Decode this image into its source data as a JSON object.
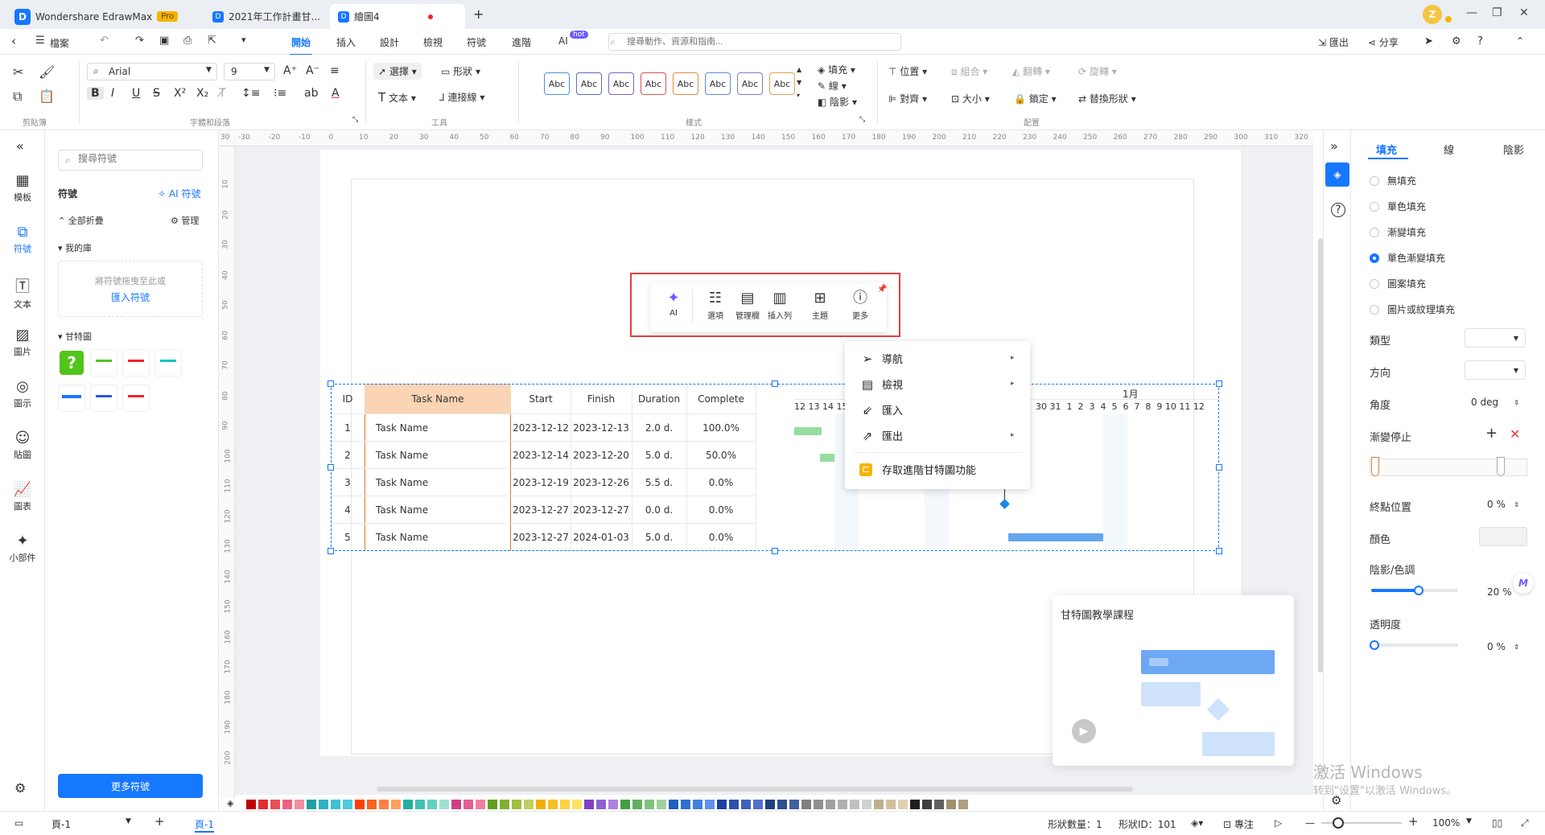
{
  "titlebar": {
    "app_logo": "D",
    "app_name": "Wondershare EdrawMax",
    "pro_badge": "Pro",
    "tabs": [
      {
        "label": "2021年工作計畫甘..."
      },
      {
        "label": "繪圖4"
      }
    ],
    "new_tab": "+",
    "avatar_letter": "Z"
  },
  "menubar": {
    "file": "檔案",
    "items": [
      "開始",
      "插入",
      "設計",
      "檢視",
      "符號",
      "進階",
      "AI"
    ],
    "ai_badge": "hot",
    "search_placeholder": "搜尋動作、資源和指南...",
    "export": "匯出",
    "share": "分享"
  },
  "ribbon": {
    "font_name": "Arial",
    "font_size": "9",
    "select": "選擇",
    "shape": "形狀",
    "text": "文本",
    "connector": "連接線",
    "style_sample": "Abc",
    "style_colors": [
      "#4a90d9",
      "#5b6abf",
      "#7b61c9",
      "#d9534f",
      "#e08a3c",
      "#5b8bd9",
      "#7a7fc9",
      "#e0a050"
    ],
    "fill": "填充",
    "line": "線",
    "shadow": "陰影",
    "position": "位置",
    "group": "組合",
    "flip": "翻轉",
    "rotate": "旋轉",
    "align": "對齊",
    "size": "大小",
    "lock": "鎖定",
    "replace_shape": "替換形狀",
    "group_labels": [
      "剪貼簿",
      "字體和段落",
      "工具",
      "樣式",
      "配置"
    ]
  },
  "leftnav": [
    {
      "label": "模板",
      "icon": "template-icon"
    },
    {
      "label": "符號",
      "icon": "symbol-icon"
    },
    {
      "label": "文本",
      "icon": "text-icon"
    },
    {
      "label": "圖片",
      "icon": "image-icon"
    },
    {
      "label": "圖示",
      "icon": "icon-icon"
    },
    {
      "label": "貼圖",
      "icon": "sticker-icon"
    },
    {
      "label": "圖表",
      "icon": "chart-icon"
    },
    {
      "label": "小部件",
      "icon": "widget-icon"
    }
  ],
  "symbols": {
    "search_placeholder": "搜尋符號",
    "title": "符號",
    "ai_symbol": "AI 符號",
    "collapse_all": "全部折疊",
    "manage": "管理",
    "my_library": "我的庫",
    "drop_hint": "將符號拖曳至此或",
    "import_link": "匯入符號",
    "gantt_section": "甘特圖",
    "more_button": "更多符號"
  },
  "ruler": {
    "h": [
      "-30",
      "-20",
      "-10",
      "0",
      "10",
      "20",
      "30",
      "40",
      "50",
      "60",
      "70",
      "80",
      "90",
      "100",
      "110",
      "120",
      "130",
      "140",
      "150",
      "160",
      "170",
      "180",
      "190",
      "200",
      "210",
      "220",
      "230",
      "240",
      "250",
      "260",
      "270",
      "280",
      "290",
      "300",
      "310",
      "320"
    ],
    "v": [
      "10",
      "20",
      "30",
      "40",
      "50",
      "60",
      "70",
      "80",
      "90",
      "100",
      "110",
      "120",
      "130",
      "140",
      "150",
      "160",
      "170",
      "180",
      "190",
      "200"
    ],
    "h_origin": "30"
  },
  "gantt": {
    "headers": [
      "ID",
      "Task Name",
      "Start",
      "Finish",
      "Duration",
      "Complete"
    ],
    "month_label": "1月",
    "day_labels": "12 13 14 15",
    "day_labels_right": "30 31  1  2  3  4  5  6  7  8  9 10 11 12",
    "rows": [
      {
        "id": "1",
        "name": "Task Name",
        "start": "2023-12-12",
        "finish": "2023-12-13",
        "duration": "2.0 d.",
        "complete": "100.0%"
      },
      {
        "id": "2",
        "name": "Task Name",
        "start": "2023-12-14",
        "finish": "2023-12-20",
        "duration": "5.0 d.",
        "complete": "50.0%"
      },
      {
        "id": "3",
        "name": "Task Name",
        "start": "2023-12-19",
        "finish": "2023-12-26",
        "duration": "5.5 d.",
        "complete": "0.0%"
      },
      {
        "id": "4",
        "name": "Task Name",
        "start": "2023-12-27",
        "finish": "2023-12-27",
        "duration": "0.0 d.",
        "complete": "0.0%"
      },
      {
        "id": "5",
        "name": "Task Name",
        "start": "2023-12-27",
        "finish": "2024-01-03",
        "duration": "5.0 d.",
        "complete": "0.0%"
      }
    ]
  },
  "floatbar": {
    "items": [
      "AI",
      "選項",
      "管理欄",
      "插入列",
      "主題",
      "更多"
    ]
  },
  "context_menu": {
    "items": [
      {
        "label": "導航",
        "submenu": true
      },
      {
        "label": "檢視",
        "submenu": true
      },
      {
        "label": "匯入",
        "submenu": false
      },
      {
        "label": "匯出",
        "submenu": true
      },
      {
        "label": "存取進階甘特圖功能",
        "submenu": false
      }
    ]
  },
  "rightpanel": {
    "tabs": [
      "填充",
      "線",
      "陰影"
    ],
    "fill_options": [
      "無填充",
      "單色填充",
      "漸變填充",
      "單色漸變填充",
      "圖案填充",
      "圖片或紋理填充"
    ],
    "selected_fill": "單色漸變填充",
    "type_label": "類型",
    "direction_label": "方向",
    "angle_label": "角度",
    "angle_value": "0 deg",
    "gradient_stops_label": "漸變停止",
    "end_position_label": "終點位置",
    "end_position_value": "0 %",
    "color_label": "顏色",
    "shade_label": "陰影/色調",
    "shade_value": "20 %",
    "shade_level": 0.55,
    "transparency_label": "透明度",
    "transparency_value": "0 %",
    "transparency_level": 0.0
  },
  "tutorial": {
    "title": "甘特圖教學課程"
  },
  "watermark": {
    "line1": "激活 Windows",
    "line2": "转到\"设置\"以激活 Windows。"
  },
  "palette": [
    "#c00000",
    "#e03030",
    "#e8505a",
    "#f06080",
    "#f090a0",
    "#20a0a0",
    "#30b0c0",
    "#40c0d0",
    "#50c8e0",
    "#ff4000",
    "#ff6020",
    "#ff8040",
    "#ffa060",
    "#20b0a0",
    "#40c0b0",
    "#60d0c0",
    "#a0e0d0",
    "#d04080",
    "#e06090",
    "#f080a0",
    "#60a020",
    "#80b030",
    "#a0c040",
    "#c0d060",
    "#f0b000",
    "#f8c020",
    "#ffd040",
    "#ffe060",
    "#8040c0",
    "#9060d0",
    "#b080e0",
    "#40a040",
    "#60b060",
    "#80c080",
    "#a0d0a0",
    "#2060c0",
    "#3070d0",
    "#4080e0",
    "#6090f0",
    "#2040a0",
    "#3050b0",
    "#4060c0",
    "#5070d0",
    "#204080",
    "#305090",
    "#4060a0",
    "#808080",
    "#909090",
    "#a0a0a0",
    "#b0b0b0",
    "#c0c0c0",
    "#d0d0d0",
    "#c0b090",
    "#d0c0a0",
    "#e0d0b0",
    "#202020",
    "#404040",
    "#606060",
    "#a09070",
    "#b0a080"
  ],
  "status": {
    "page_selector": "頁-1",
    "page_tab": "頁-1",
    "shape_count_label": "形狀數量：",
    "shape_count": "1",
    "shape_id_label": "形狀ID：",
    "shape_id": "101",
    "focus": "專注",
    "zoom": "100%"
  }
}
